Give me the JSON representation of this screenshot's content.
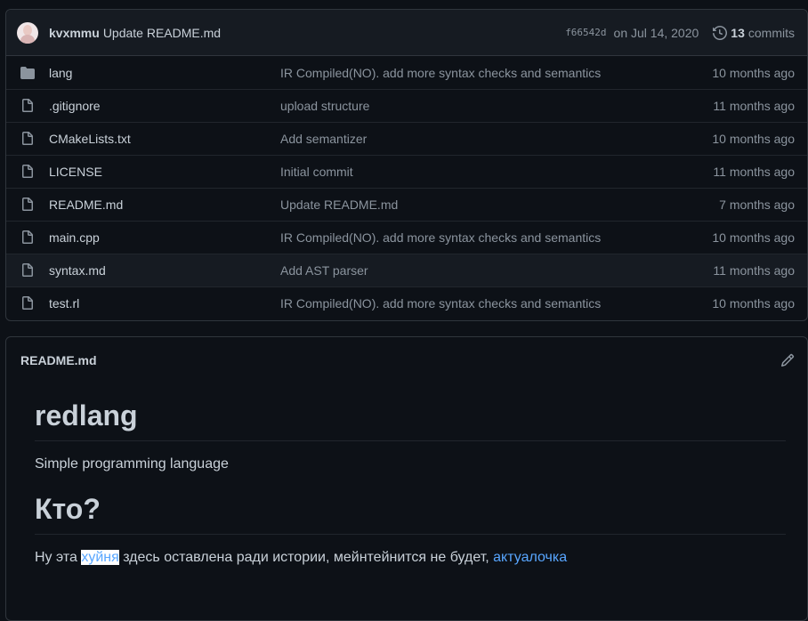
{
  "commit": {
    "author": "kvxmmu",
    "message": "Update README.md",
    "sha": "f66542d",
    "date": "on Jul 14, 2020",
    "commit_count": "13",
    "commits_label": "commits"
  },
  "files": [
    {
      "type": "folder",
      "name": "lang",
      "message": "IR Compiled(NO). add more syntax checks and semantics",
      "age": "10 months ago"
    },
    {
      "type": "file",
      "name": ".gitignore",
      "message": "upload structure",
      "age": "11 months ago"
    },
    {
      "type": "file",
      "name": "CMakeLists.txt",
      "message": "Add semantizer",
      "age": "10 months ago"
    },
    {
      "type": "file",
      "name": "LICENSE",
      "message": "Initial commit",
      "age": "11 months ago"
    },
    {
      "type": "file",
      "name": "README.md",
      "message": "Update README.md",
      "age": "7 months ago"
    },
    {
      "type": "file",
      "name": "main.cpp",
      "message": "IR Compiled(NO). add more syntax checks and semantics",
      "age": "10 months ago"
    },
    {
      "type": "file",
      "name": "syntax.md",
      "message": "Add AST parser",
      "age": "11 months ago"
    },
    {
      "type": "file",
      "name": "test.rl",
      "message": "IR Compiled(NO). add more syntax checks and semantics",
      "age": "10 months ago"
    }
  ],
  "readme": {
    "title": "README.md",
    "h1": "redlang",
    "intro": "Simple programming language",
    "h2": "Кто?",
    "p_before": "Ну эта ",
    "p_selected": "хуйня",
    "p_middle": " здесь оставлена ради истории, мейнтейнится не будет, ",
    "p_link": "актуалочка"
  },
  "colors": {
    "background": "#0d1117",
    "border": "#30363d",
    "link": "#58a6ff",
    "muted": "#8b949e",
    "text": "#c9d1d9"
  },
  "icons": {
    "folder": "folder-icon",
    "file": "file-icon",
    "history": "history-icon",
    "edit": "pencil-icon"
  }
}
